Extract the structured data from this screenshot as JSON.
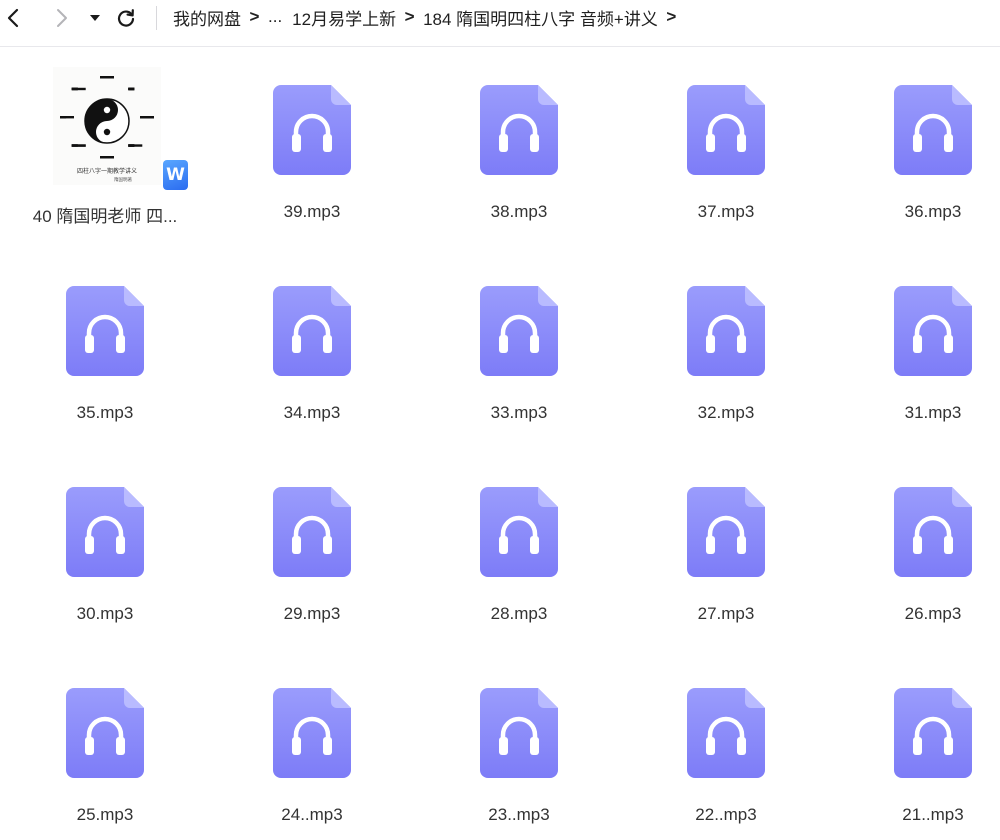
{
  "toolbar": {
    "breadcrumb": {
      "root": "我的网盘",
      "ellipsis": "...",
      "parent": "12月易学上新",
      "current": "184 隋国明四柱八字 音频+讲义",
      "separator": ">"
    }
  },
  "colors": {
    "audio_icon_top": "#9a9cfc",
    "audio_icon_bottom": "#7d7cf7",
    "audio_icon_fold": "#b9bbff",
    "headphone": "#ffffff",
    "wps_badge": "#2f74f2"
  },
  "files": [
    {
      "name": "40 隋国明老师 四...",
      "type": "doc",
      "icon": "wps-document-icon",
      "cover_title": "四柱八字一期教学讲义",
      "cover_author": "隋国明著"
    },
    {
      "name": "39.mp3",
      "type": "audio",
      "icon": "audio-file-icon"
    },
    {
      "name": "38.mp3",
      "type": "audio",
      "icon": "audio-file-icon"
    },
    {
      "name": "37.mp3",
      "type": "audio",
      "icon": "audio-file-icon"
    },
    {
      "name": "36.mp3",
      "type": "audio",
      "icon": "audio-file-icon"
    },
    {
      "name": "35.mp3",
      "type": "audio",
      "icon": "audio-file-icon"
    },
    {
      "name": "34.mp3",
      "type": "audio",
      "icon": "audio-file-icon"
    },
    {
      "name": "33.mp3",
      "type": "audio",
      "icon": "audio-file-icon"
    },
    {
      "name": "32.mp3",
      "type": "audio",
      "icon": "audio-file-icon"
    },
    {
      "name": "31.mp3",
      "type": "audio",
      "icon": "audio-file-icon"
    },
    {
      "name": "30.mp3",
      "type": "audio",
      "icon": "audio-file-icon"
    },
    {
      "name": "29.mp3",
      "type": "audio",
      "icon": "audio-file-icon"
    },
    {
      "name": "28.mp3",
      "type": "audio",
      "icon": "audio-file-icon"
    },
    {
      "name": "27.mp3",
      "type": "audio",
      "icon": "audio-file-icon"
    },
    {
      "name": "26.mp3",
      "type": "audio",
      "icon": "audio-file-icon"
    },
    {
      "name": "25.mp3",
      "type": "audio",
      "icon": "audio-file-icon"
    },
    {
      "name": "24..mp3",
      "type": "audio",
      "icon": "audio-file-icon"
    },
    {
      "name": "23..mp3",
      "type": "audio",
      "icon": "audio-file-icon"
    },
    {
      "name": "22..mp3",
      "type": "audio",
      "icon": "audio-file-icon"
    },
    {
      "name": "21..mp3",
      "type": "audio",
      "icon": "audio-file-icon"
    }
  ]
}
